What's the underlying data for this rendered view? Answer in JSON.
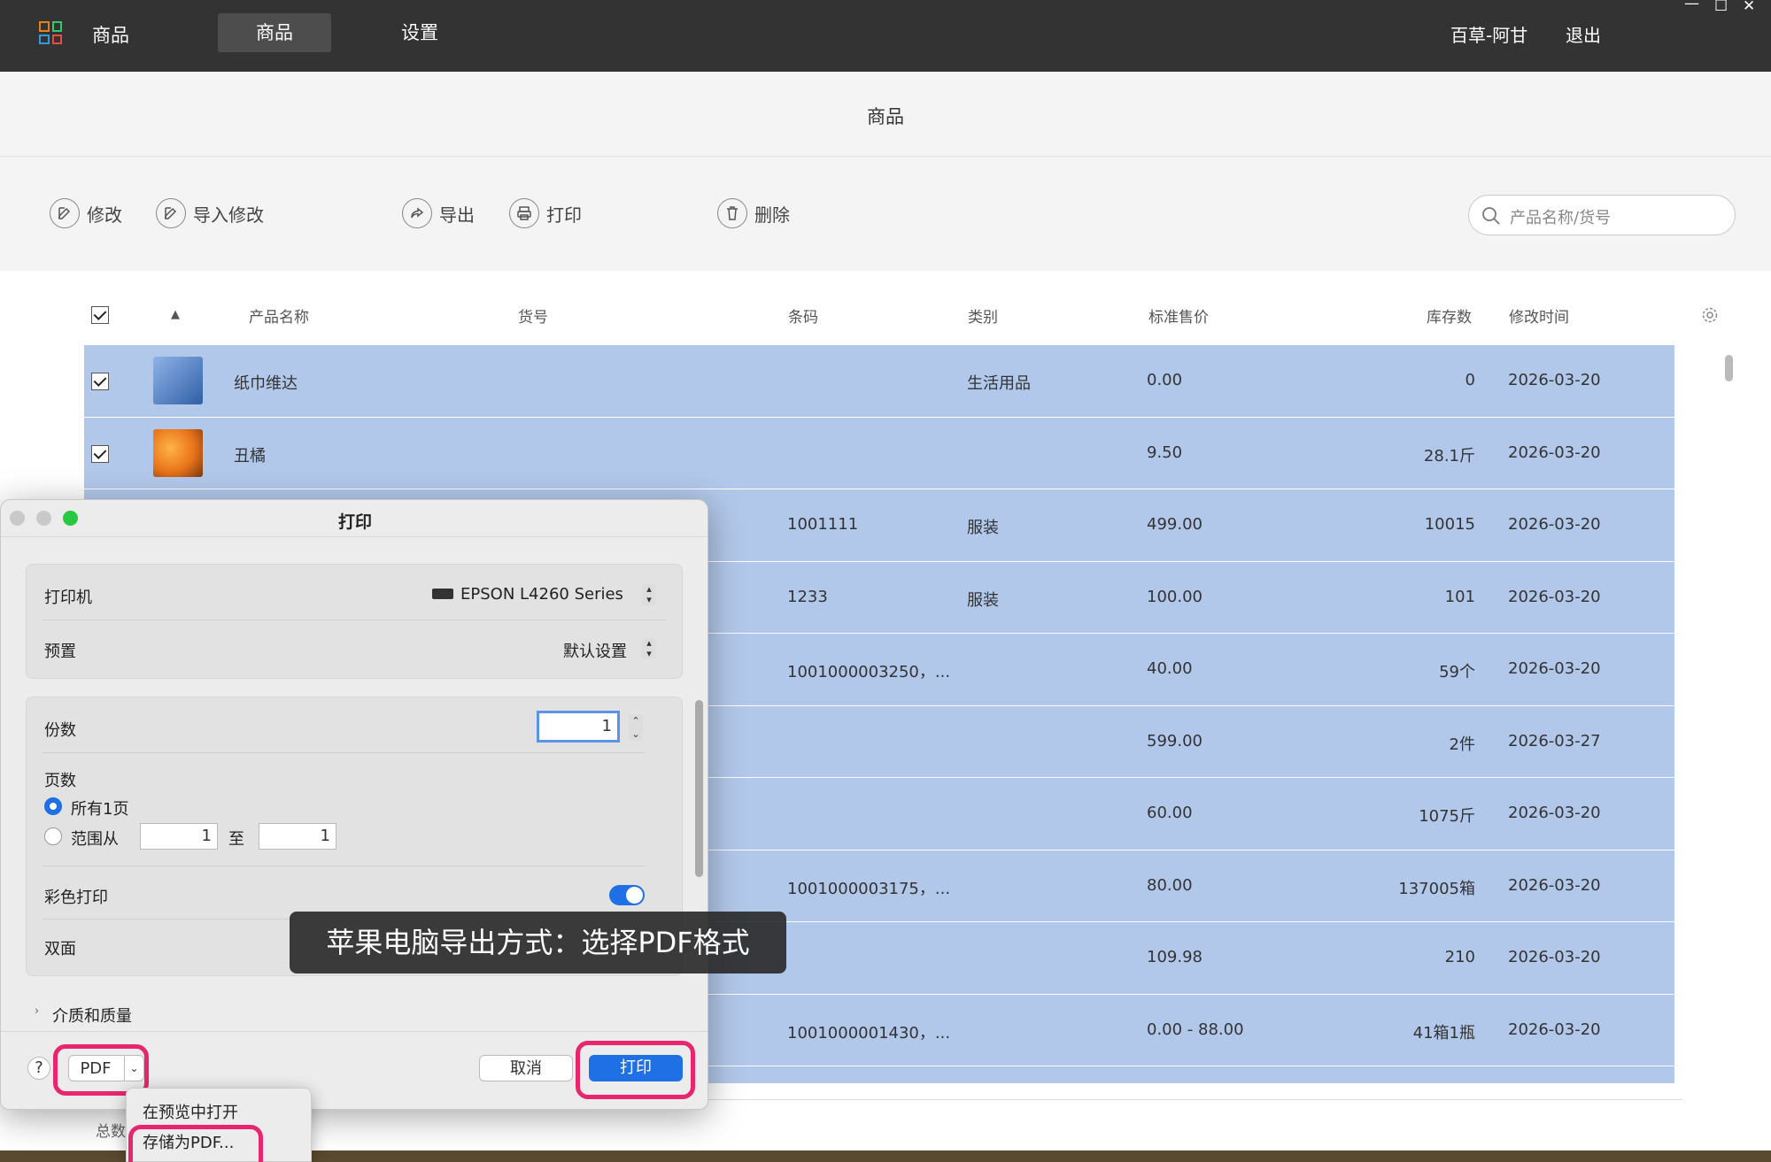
{
  "topbar": {
    "app_name": "商品",
    "nav_products": "商品",
    "nav_settings": "设置",
    "user": "百草-阿甘",
    "logout": "退出"
  },
  "page": {
    "title": "商品"
  },
  "toolbar": {
    "edit": "修改",
    "import_edit": "导入修改",
    "export": "导出",
    "print": "打印",
    "delete": "删除",
    "search_placeholder": "产品名称/货号"
  },
  "table": {
    "sort_indicator": "▲",
    "headers": {
      "name": "产品名称",
      "sku": "货号",
      "barcode": "条码",
      "category": "类别",
      "price": "标准售价",
      "stock": "库存数",
      "modified": "修改时间"
    },
    "rows": [
      {
        "name": "纸巾维达",
        "barcode": "",
        "category": "生活用品",
        "price": "0.00",
        "stock": "0",
        "modified": "2026-03-20"
      },
      {
        "name": "丑橘",
        "barcode": "",
        "category": "",
        "price": "9.50",
        "stock": "28.1斤",
        "modified": "2026-03-20"
      },
      {
        "name": "",
        "barcode": "1001111",
        "category": "服装",
        "price": "499.00",
        "stock": "10015",
        "modified": "2026-03-20"
      },
      {
        "name": "",
        "barcode": "1233",
        "category": "服装",
        "price": "100.00",
        "stock": "101",
        "modified": "2026-03-20"
      },
      {
        "name": "",
        "barcode": "1001000003250，...",
        "category": "",
        "price": "40.00",
        "stock": "59个",
        "modified": "2026-03-20"
      },
      {
        "name": "",
        "barcode": "",
        "category": "",
        "price": "599.00",
        "stock": "2件",
        "modified": "2026-03-27"
      },
      {
        "name": "",
        "barcode": "",
        "category": "",
        "price": "60.00",
        "stock": "1075斤",
        "modified": "2026-03-20"
      },
      {
        "name": "",
        "barcode": "1001000003175，...",
        "category": "",
        "price": "80.00",
        "stock": "137005箱",
        "modified": "2026-03-20"
      },
      {
        "name": "",
        "barcode": "",
        "category": "",
        "price": "109.98",
        "stock": "210",
        "modified": "2026-03-20"
      },
      {
        "name": "",
        "barcode": "1001000001430，...",
        "category": "",
        "price": "0.00 - 88.00",
        "stock": "41箱1瓶",
        "modified": "2026-03-20"
      }
    ],
    "total_label": "总数"
  },
  "print_dialog": {
    "title": "打印",
    "printer_label": "打印机",
    "printer_value": "EPSON L4260 Series",
    "preset_label": "预置",
    "preset_value": "默认设置",
    "copies_label": "份数",
    "copies_value": "1",
    "pages_label": "页数",
    "all_pages": "所有1页",
    "range_label": "范围从",
    "range_from": "1",
    "range_to_label": "至",
    "range_to": "1",
    "color_label": "彩色打印",
    "duplex_label": "双面",
    "media_label": "介质和质量",
    "help": "?",
    "pdf_button": "PDF",
    "cancel": "取消",
    "print": "打印"
  },
  "pdf_menu": {
    "open_in_preview": "在预览中打开",
    "save_as_pdf": "存储为PDF..."
  },
  "tooltip": {
    "text": "苹果电脑导出方式：选择PDF格式"
  },
  "colors": {
    "topbar": "#333333",
    "row_selected": "#b2c8ea",
    "accent_blue": "#1f6fe5",
    "highlight": "#e8266e"
  }
}
